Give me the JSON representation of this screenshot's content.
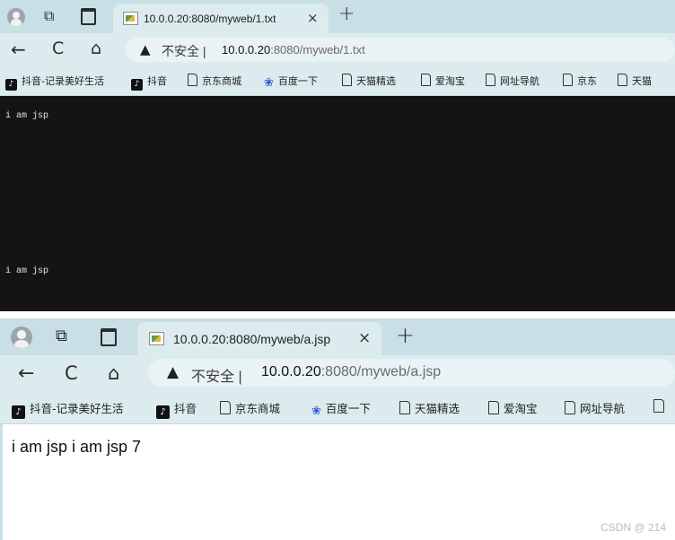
{
  "window_top": {
    "tab": {
      "title": "10.0.0.20:8080/myweb/1.txt",
      "close": "×"
    },
    "new_tab": "+",
    "nav": {
      "back": "←",
      "reload": "C",
      "home": "⌂"
    },
    "omnibox": {
      "warning": "▲",
      "security_label": "不安全",
      "separator": "|",
      "url_host": "10.0.0.20",
      "url_rest": ":8080/myweb/1.txt"
    },
    "bookmarks": [
      {
        "label": "抖音-记录美好生活",
        "icon": "tiktok-icon"
      },
      {
        "label": "抖音",
        "icon": "tiktok-icon"
      },
      {
        "label": "京东商城",
        "icon": "page-icon"
      },
      {
        "label": "百度一下",
        "icon": "baidu-paw-icon"
      },
      {
        "label": "天猫精选",
        "icon": "page-icon"
      },
      {
        "label": "爱淘宝",
        "icon": "page-icon"
      },
      {
        "label": "网址导航",
        "icon": "page-icon"
      },
      {
        "label": "京东",
        "icon": "page-icon"
      },
      {
        "label": "天猫",
        "icon": "page-icon"
      }
    ],
    "content": {
      "line1": "i am jsp",
      "line2": "i am jsp",
      "background": "#141414"
    }
  },
  "window_bottom": {
    "tab": {
      "title": "10.0.0.20:8080/myweb/a.jsp",
      "close": "×"
    },
    "new_tab": "+",
    "nav": {
      "back": "←",
      "reload": "C",
      "home": "⌂"
    },
    "omnibox": {
      "warning": "▲",
      "security_label": "不安全",
      "separator": "|",
      "url_host": "10.0.0.20",
      "url_rest": ":8080/myweb/a.jsp"
    },
    "bookmarks": [
      {
        "label": "抖音-记录美好生活",
        "icon": "tiktok-icon"
      },
      {
        "label": "抖音",
        "icon": "tiktok-icon"
      },
      {
        "label": "京东商城",
        "icon": "page-icon"
      },
      {
        "label": "百度一下",
        "icon": "baidu-paw-icon"
      },
      {
        "label": "天猫精选",
        "icon": "page-icon"
      },
      {
        "label": "爱淘宝",
        "icon": "page-icon"
      },
      {
        "label": "网址导航",
        "icon": "page-icon"
      },
      {
        "label": "",
        "icon": "page-icon"
      }
    ],
    "content": {
      "text": "i am jsp i am jsp 7"
    }
  },
  "watermark": "CSDN @ 214",
  "colors": {
    "tabbar": "#c8dfe5",
    "toolbar": "#dcebee",
    "baidu_blue": "#2f5cd6"
  }
}
